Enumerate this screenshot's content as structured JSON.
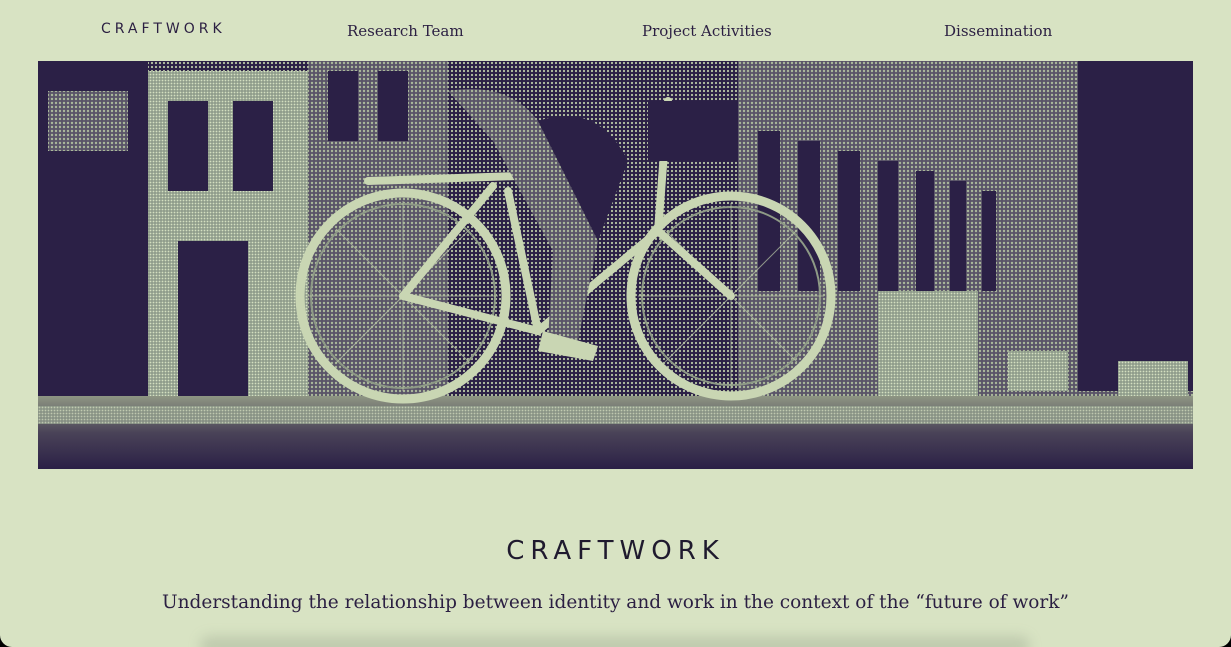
{
  "header": {
    "logo": "CRAFTWORK",
    "nav": [
      {
        "label": "Research Team"
      },
      {
        "label": "Project Activities"
      },
      {
        "label": "Dissemination"
      }
    ]
  },
  "hero": {
    "image": "bicycle-street-halftone-photo"
  },
  "main": {
    "title": "CRAFTWORK",
    "tagline": "Understanding the relationship between identity and work in the context of the “future of work”"
  },
  "colors": {
    "background": "#d8e3c3",
    "ink": "#2b1f42",
    "image_dark": "#2b2046",
    "image_light": "#c9d6b3"
  }
}
